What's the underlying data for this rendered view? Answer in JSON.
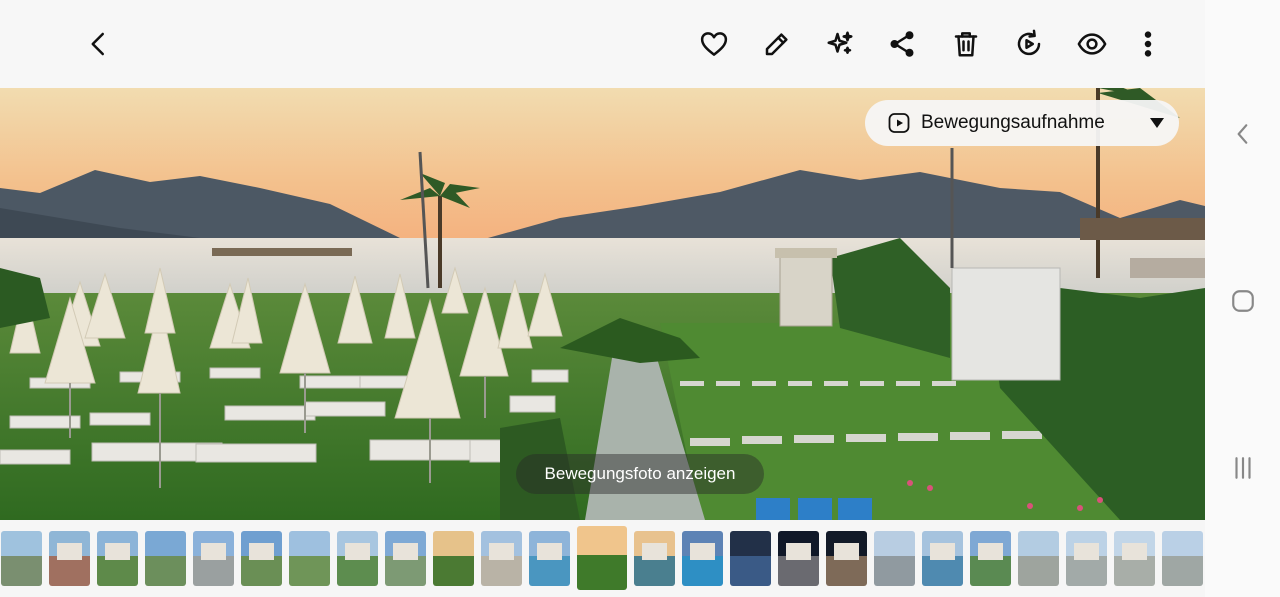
{
  "toolbar": {
    "back_icon": "chevron-left-icon",
    "actions": [
      "heart-icon",
      "pencil-icon",
      "sparkle-icon",
      "share-icon",
      "trash-icon",
      "motion-replay-icon",
      "eye-icon",
      "more-vertical-icon"
    ]
  },
  "photo": {
    "motion_toggle_label": "Bewegungsaufnahme",
    "view_motion_label": "Bewegungsfoto anzeigen"
  },
  "sidenav": {
    "icons": [
      "back-icon",
      "home-icon",
      "recents-icon"
    ]
  },
  "colors": {
    "sky_top": "#f1d29a",
    "sky_bottom": "#f4b483",
    "mountain": "#4a5560",
    "sea": "#d9d8d3",
    "lawn": "#3f7a2a",
    "umbrella": "#ece6d6"
  },
  "filmstrip": {
    "thumbnails": [
      {
        "sky": "#9fc2de",
        "ground": "#7a8f70"
      },
      {
        "sky": "#8fb6d6",
        "ground": "#a07060"
      },
      {
        "sky": "#8cb4d8",
        "ground": "#5e8a4a"
      },
      {
        "sky": "#7aa8d4",
        "ground": "#6c8f5c"
      },
      {
        "sky": "#8ab1da",
        "ground": "#9aa0a0"
      },
      {
        "sky": "#6f9fd0",
        "ground": "#6a8f55"
      },
      {
        "sky": "#9ec0df",
        "ground": "#6f9558"
      },
      {
        "sky": "#a8c6e0",
        "ground": "#5d8d4f"
      },
      {
        "sky": "#7ea9d5",
        "ground": "#7d9a74"
      },
      {
        "sky": "#e6c28a",
        "ground": "#4b7a33"
      },
      {
        "sky": "#a3c1df",
        "ground": "#b9b3a6"
      },
      {
        "sky": "#8eb4d9",
        "ground": "#4a96c0"
      },
      {
        "sky": "#f0c58c",
        "ground": "#3f7a2a"
      },
      {
        "sky": "#e8c28e",
        "ground": "#4a7f8f"
      },
      {
        "sky": "#5d83b5",
        "ground": "#2e8fc4"
      },
      {
        "sky": "#223048",
        "ground": "#3a5a86"
      },
      {
        "sky": "#101828",
        "ground": "#6a6a70"
      },
      {
        "sky": "#121a28",
        "ground": "#7e6a58"
      },
      {
        "sky": "#b8cde2",
        "ground": "#909aa0"
      },
      {
        "sky": "#a6c3de",
        "ground": "#4f8ab0"
      },
      {
        "sky": "#7fa8d4",
        "ground": "#5a8a52"
      },
      {
        "sky": "#b3cce2",
        "ground": "#9ea49e"
      },
      {
        "sky": "#bcd2e6",
        "ground": "#a2aaa8"
      },
      {
        "sky": "#c2d6e8",
        "ground": "#a8aea8"
      },
      {
        "sky": "#bad0e6",
        "ground": "#9fa7a4"
      }
    ],
    "selected_index": 12
  }
}
